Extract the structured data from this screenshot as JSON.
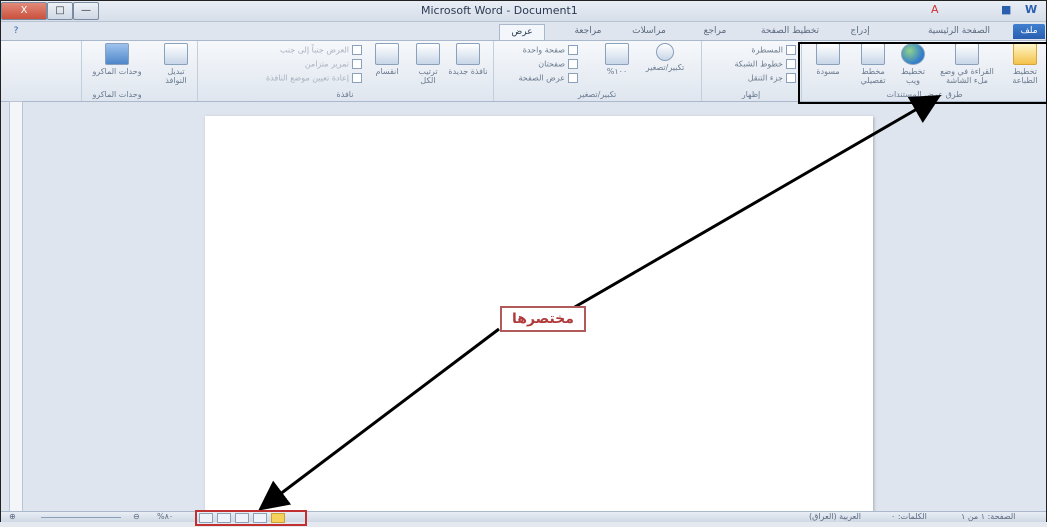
{
  "window": {
    "title": "Microsoft Word - Document1",
    "buttons": {
      "close": "X",
      "restore": "□",
      "minimize": "—"
    }
  },
  "tabs": [
    "ملف",
    "الصفحة الرئيسية",
    "إدراج",
    "تخطيط الصفحة",
    "مراجع",
    "مراسلات",
    "مراجعة",
    "عرض"
  ],
  "ribbon": {
    "views_group": {
      "label": "طرق عرض المستندات",
      "buttons": [
        "تخطيط الطباعة",
        "القراءة في وضع ملء الشاشة",
        "تخطيط ويب",
        "مخطط تفصيلي",
        "مسودة"
      ]
    },
    "show_group": {
      "label": "إظهار",
      "options": [
        "المسطرة",
        "خطوط الشبكة",
        "جزء التنقل"
      ]
    },
    "zoom_group": {
      "label": "تكبير/تصغير",
      "buttons": [
        "تكبير/تصغير",
        "%١٠٠",
        "صفحة واحدة",
        "صفحتان",
        "عرض الصفحة"
      ]
    },
    "window_group": {
      "label": "نافذة",
      "buttons": [
        "نافذة جديدة",
        "ترتيب الكل",
        "انقسام"
      ],
      "options": [
        "العرض جنباً إلى جنب",
        "تمرير متزامن",
        "إعادة تعيين موضع النافذة"
      ],
      "switch": "تبديل النوافذ"
    },
    "macros_group": {
      "label": "وحدات الماكرو",
      "button": "وحدات الماكرو"
    }
  },
  "callout": {
    "text": "مختصرها"
  },
  "statusbar": {
    "page": "الصفحة: ١ من ١",
    "words": "الكلمات: ٠",
    "language": "العربية (العراق)",
    "zoom": "%٨٠"
  },
  "colors": {
    "file_tab": "#2a5fb0",
    "callout_border": "#b05a5a",
    "highlight_box": "#000000",
    "statusbar_box": "#c03030"
  }
}
